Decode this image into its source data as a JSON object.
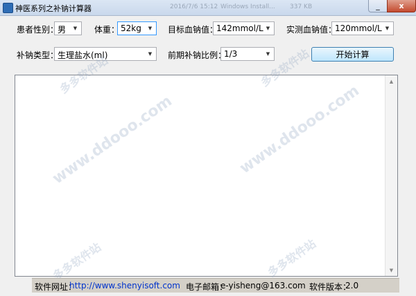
{
  "window": {
    "title": "神医系列之补钠计算器",
    "ghost_titles": [
      "2016/7/6 15:12",
      "Windows Install...",
      "337 KB"
    ],
    "close_glyph": "x",
    "minimize_glyph": "_"
  },
  "form": {
    "gender_label": "患者性别：",
    "gender_value": "男",
    "weight_label": "体重：",
    "weight_value": "52kg",
    "target_label": "目标血钠值：",
    "target_value": "142mmol/L",
    "measured_label": "实测血钠值：",
    "measured_value": "120mmol/L",
    "type_label": "补钠类型：",
    "type_value": "生理盐水(ml)",
    "ratio_label": "前期补钠比例：",
    "ratio_value": "1/3",
    "calculate_label": "开始计算"
  },
  "result": {
    "text": ""
  },
  "status": {
    "website_label": "软件网址：",
    "website_url": "http://www.shenyisoft.com",
    "email_label": "电子邮箱：",
    "email_value": "e-yisheng@163.com",
    "version_label": "软件版本：",
    "version_value": "2.0"
  },
  "watermarks": {
    "url": "www.ddooo.com",
    "cn": "多多软件站"
  },
  "icons": {
    "dropdown": "▼",
    "scroll_up": "▲",
    "scroll_down": "▼"
  }
}
